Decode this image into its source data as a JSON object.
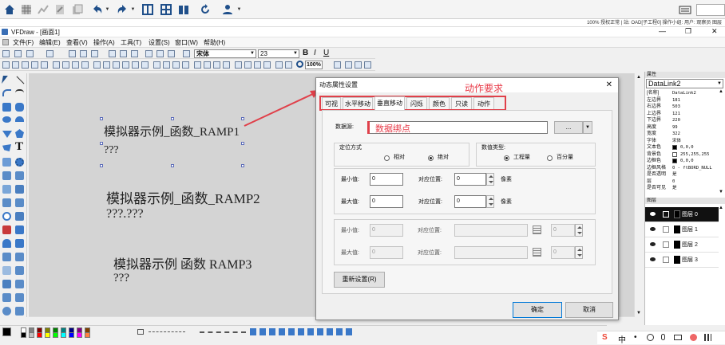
{
  "toolbar": {
    "search_value": ""
  },
  "sysbar": {
    "text": "100% 授权正常 | 站: OAD[子工程0] 操作小组: 用户: 观察员 图层"
  },
  "titlebar": {
    "app_title": "VFDraw - [画面1]"
  },
  "menu": [
    "文件(F)",
    "编辑(E)",
    "查看(V)",
    "操作(A)",
    "工具(T)",
    "设置(S)",
    "窗口(W)",
    "帮助(H)"
  ],
  "format": {
    "font_name": "宋体",
    "font_size": "23",
    "zoom": "100%",
    "bold": "B",
    "italic": "I",
    "underline": "U"
  },
  "left_palette": {
    "text_tool": "T"
  },
  "canvas": {
    "items": [
      {
        "name": "模拟器示例_函数_RAMP1",
        "value": "???"
      },
      {
        "name": "模拟器示例_函数_RAMP2",
        "value": "???.???"
      },
      {
        "name": "模拟器示例 函数 RAMP3",
        "value": "???"
      }
    ]
  },
  "properties": {
    "header": "属性",
    "object": "DataLink2",
    "rows": [
      {
        "key": "[名称]",
        "value": "DataLink2"
      },
      {
        "key": "左边界",
        "value": "181"
      },
      {
        "key": "右边界",
        "value": "503"
      },
      {
        "key": "上边界",
        "value": "121"
      },
      {
        "key": "下边界",
        "value": "220"
      },
      {
        "key": "高度",
        "value": "99"
      },
      {
        "key": "宽度",
        "value": "322"
      },
      {
        "key": "字体",
        "value": "宋体"
      },
      {
        "key": "文本色",
        "value": "0,0,0"
      },
      {
        "key": "背景色",
        "value": "255,255,255"
      },
      {
        "key": "边框色",
        "value": "0,0,0"
      },
      {
        "key": "边框风格",
        "value": "0 - ftBORD_NULL"
      },
      {
        "key": "是否透明",
        "value": "是"
      },
      {
        "key": "层",
        "value": "0"
      },
      {
        "key": "是否可见",
        "value": "是"
      }
    ],
    "swatches": {
      "文本色": "#000000",
      "背景色": "#ffffff",
      "边框色": "#000000"
    }
  },
  "layers": {
    "header": "图层",
    "items": [
      "图层 0",
      "图层 1",
      "图层 2",
      "图层 3"
    ]
  },
  "dialog": {
    "title": "动态属性设置",
    "tabs": [
      "可视",
      "水平移动",
      "垂直移动",
      "闪烁",
      "颜色",
      "只读",
      "动作"
    ],
    "annotation_tabs": "动作要求",
    "data_source_label": "数据源:",
    "data_source_value": "",
    "annotation_binding": "数据绑点",
    "browse_label": "...",
    "locate_group": "定位方式",
    "locate_options": [
      "相对",
      "绝对"
    ],
    "locate_selected": "绝对",
    "numtype_group": "数值类型:",
    "numtype_options": [
      "工程量",
      "百分量"
    ],
    "numtype_selected": "工程量",
    "min_label": "最小值:",
    "max_label": "最大值:",
    "min_value": "0",
    "max_value": "0",
    "pos_label": "对应位置:",
    "pos_min": "0",
    "pos_max": "0",
    "unit": "像素",
    "dis_min": "0",
    "dis_max": "0",
    "dis_pos1": "0",
    "dis_pos2": "0",
    "reset_label": "重新设置(R)",
    "ok_label": "确定",
    "cancel_label": "取消"
  },
  "accent": {
    "annotation_red": "#e0404a",
    "selection_blue": "#5b6bb8"
  }
}
